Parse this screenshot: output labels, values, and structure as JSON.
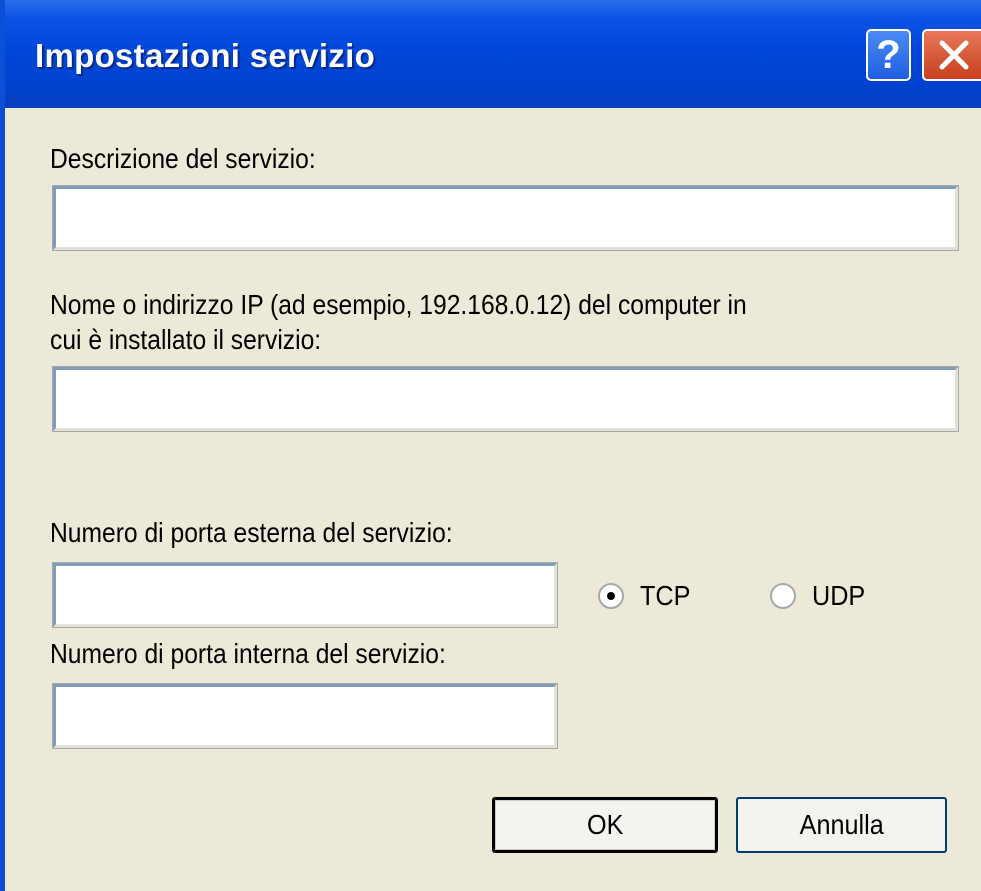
{
  "dialog": {
    "title": "Impostazioni servizio",
    "help_icon": "help-icon",
    "close_icon": "close-icon",
    "description_label": "Descrizione del servizio:",
    "description_value": "",
    "host_label_line1": "Nome o indirizzo IP (ad esempio, 192.168.0.12) del computer in",
    "host_label_line2": "cui è installato il servizio:",
    "host_value": "",
    "external_port_label": "Numero di porta esterna del servizio:",
    "external_port_value": "",
    "internal_port_label": "Numero di porta interna del servizio:",
    "internal_port_value": "",
    "protocol": {
      "options": [
        "TCP",
        "UDP"
      ],
      "selected": "TCP"
    },
    "ok_label": "OK",
    "cancel_label": "Annulla"
  },
  "colors": {
    "titlebar": "#0046D8",
    "background": "#ECE9D8",
    "close_button": "#D9532E"
  }
}
